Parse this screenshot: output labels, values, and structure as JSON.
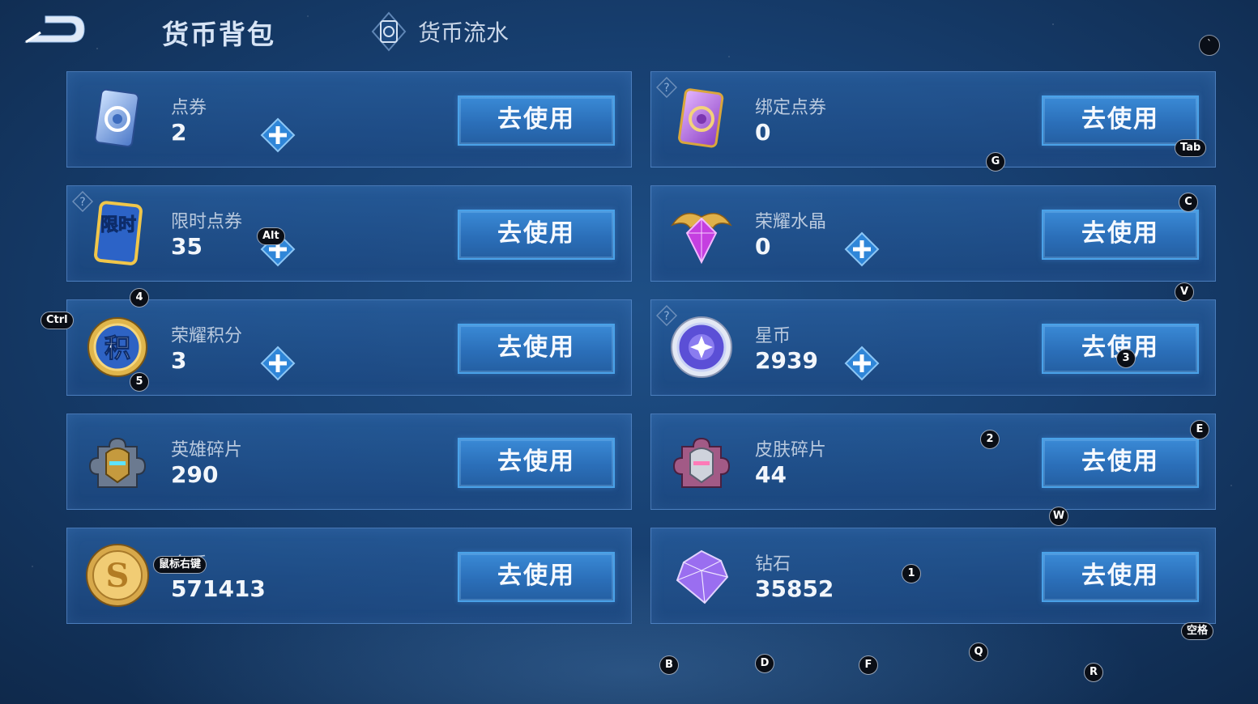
{
  "header": {
    "title": "货币背包",
    "flow_tab_label": "货币流水"
  },
  "currencies": [
    {
      "name": "点券",
      "value": "2",
      "action": "去使用",
      "icon": "blue-coupon-card-icon"
    },
    {
      "name": "绑定点券",
      "value": "0",
      "action": "去使用",
      "icon": "purple-bound-coupon-card-icon"
    },
    {
      "name": "限时点券",
      "value": "35",
      "action": "去使用",
      "icon": "limited-time-coupon-icon",
      "icon_text": "限时"
    },
    {
      "name": "荣耀水晶",
      "value": "0",
      "action": "去使用",
      "icon": "glory-crystal-icon"
    },
    {
      "name": "荣耀积分",
      "value": "3",
      "action": "去使用",
      "icon": "glory-points-coin-icon",
      "icon_text": "积"
    },
    {
      "name": "星币",
      "value": "2939",
      "action": "去使用",
      "icon": "star-coin-icon"
    },
    {
      "name": "英雄碎片",
      "value": "290",
      "action": "去使用",
      "icon": "hero-fragment-icon"
    },
    {
      "name": "皮肤碎片",
      "value": "44",
      "action": "去使用",
      "icon": "skin-fragment-icon"
    },
    {
      "name": "金币",
      "value": "571413",
      "action": "去使用",
      "icon": "gold-coin-icon"
    },
    {
      "name": "钻石",
      "value": "35852",
      "action": "去使用",
      "icon": "diamond-icon"
    }
  ],
  "key_hints": {
    "backtick": "`",
    "tab": "Tab",
    "g": "G",
    "c": "C",
    "alt": "Alt",
    "four": "4",
    "v": "V",
    "ctrl": "Ctrl",
    "five": "5",
    "three": "3",
    "two": "2",
    "e": "E",
    "w": "W",
    "right_click": "鼠标右键",
    "one": "1",
    "space": "空格",
    "q": "Q",
    "b": "B",
    "d": "D",
    "f": "F",
    "r": "R"
  },
  "colors": {
    "button_fill": "#2b6fb9",
    "button_border": "#4aa2e8",
    "plus_fill": "#2f86d8",
    "card_border": "#6ea0e1",
    "background": "#173f70"
  }
}
